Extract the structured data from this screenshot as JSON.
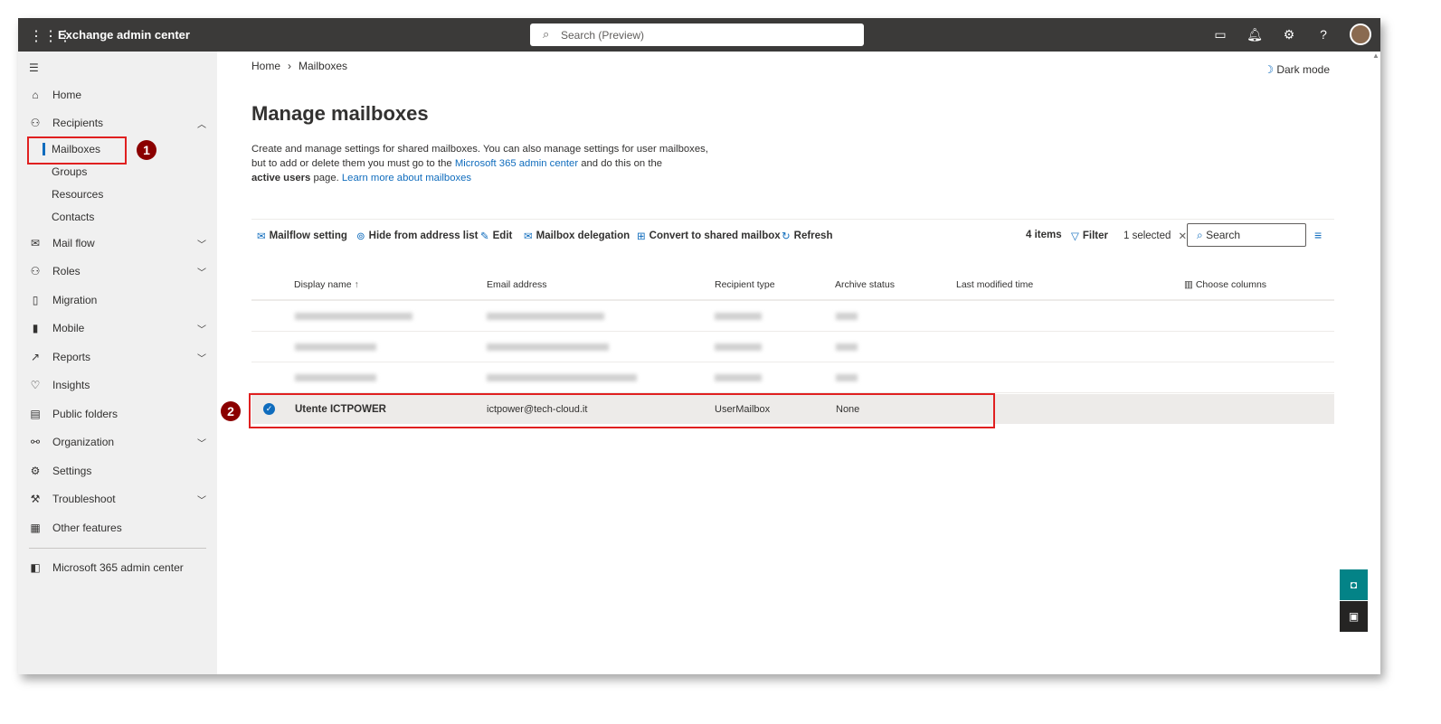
{
  "header": {
    "title": "Exchange admin center",
    "search_placeholder": "Search (Preview)"
  },
  "sidebar": {
    "items": [
      {
        "label": "Home",
        "icon": "home-icon"
      },
      {
        "label": "Recipients",
        "icon": "person-icon"
      },
      {
        "label": "Mail flow",
        "icon": "mail-icon"
      },
      {
        "label": "Roles",
        "icon": "roles-icon"
      },
      {
        "label": "Migration",
        "icon": "migration-icon"
      },
      {
        "label": "Mobile",
        "icon": "mobile-icon"
      },
      {
        "label": "Reports",
        "icon": "chart-icon"
      },
      {
        "label": "Insights",
        "icon": "lightbulb-icon"
      },
      {
        "label": "Public folders",
        "icon": "folder-icon"
      },
      {
        "label": "Organization",
        "icon": "org-icon"
      },
      {
        "label": "Settings",
        "icon": "gear-icon"
      },
      {
        "label": "Troubleshoot",
        "icon": "wrench-icon"
      },
      {
        "label": "Other features",
        "icon": "grid-icon"
      }
    ],
    "recipients_sub": [
      "Mailboxes",
      "Groups",
      "Resources",
      "Contacts"
    ],
    "m365": "Microsoft 365 admin center"
  },
  "breadcrumb": {
    "home": "Home",
    "current": "Mailboxes"
  },
  "dark_mode": "Dark mode",
  "page": {
    "title": "Manage mailboxes",
    "desc1": "Create and manage settings for shared mailboxes. You can also manage settings for user mailboxes,",
    "desc2a": "but to add or delete them you must go to the ",
    "desc2link": "Microsoft 365 admin center",
    "desc2b": " and do this on the",
    "desc3bold": "active users",
    "desc3a": " page. ",
    "desc3link": "Learn more about mailboxes"
  },
  "toolbar": {
    "mailflow": "Mailflow setting",
    "hide": "Hide from address list",
    "edit": "Edit",
    "delegation": "Mailbox delegation",
    "convert": "Convert to shared mailbox",
    "refresh": "Refresh",
    "count": "4 items",
    "filter": "Filter",
    "selected": "1 selected",
    "search": "Search"
  },
  "table": {
    "headers": [
      "Display name",
      "Email address",
      "Recipient type",
      "Archive status",
      "Last modified time"
    ],
    "choose_columns": "Choose columns",
    "selected_row": {
      "name": "Utente ICTPOWER",
      "email": "ictpower@tech-cloud.it",
      "type": "UserMailbox",
      "archive": "None"
    }
  },
  "annotations": [
    "1",
    "2"
  ]
}
